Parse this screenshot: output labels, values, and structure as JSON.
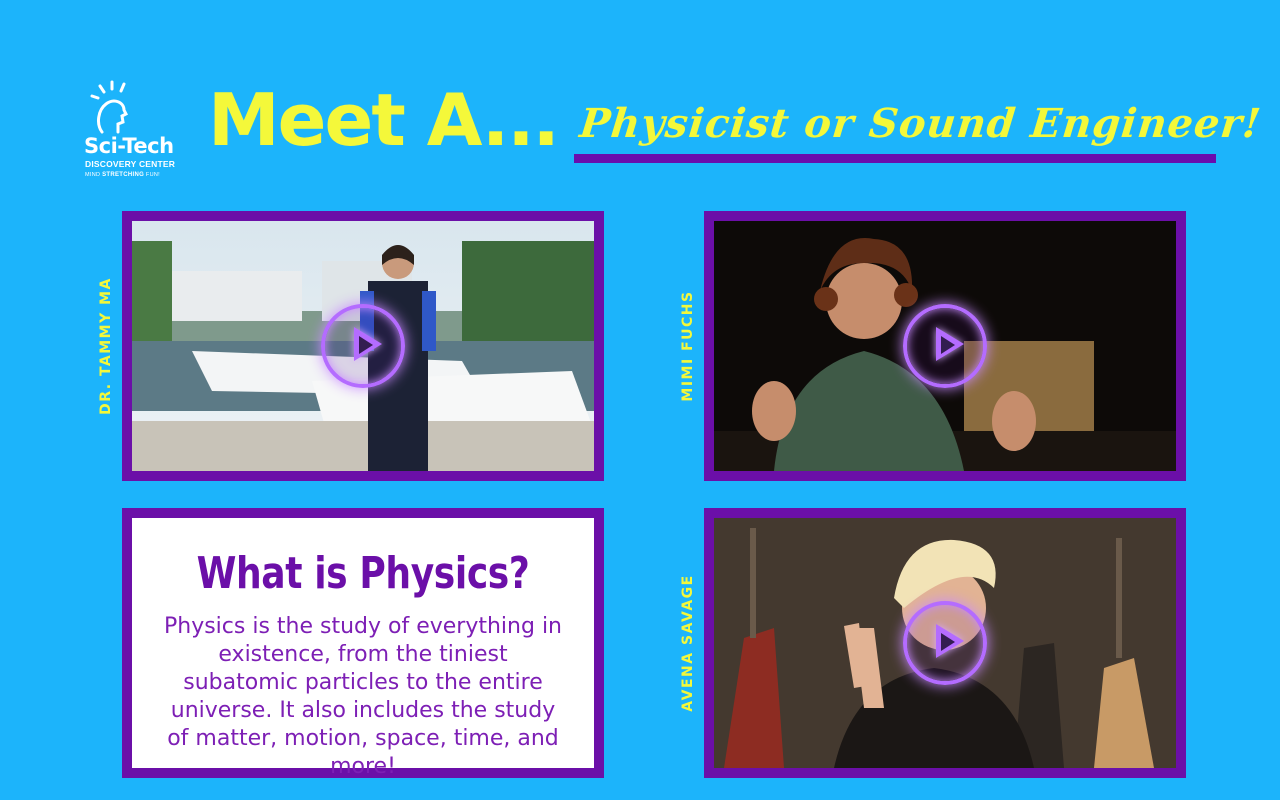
{
  "logo": {
    "brand": "Sci-Tech",
    "subtitle": "DISCOVERY CENTER",
    "tagline_pre": "MIND",
    "tagline_bold": "STRETCHING",
    "tagline_post": "FUN!"
  },
  "header": {
    "title": "Meet A...",
    "subtitle": "Physicist or Sound Engineer!"
  },
  "videos": [
    {
      "name": "DR. TAMMY MA",
      "thumbnail": "person-on-dock-with-boats"
    },
    {
      "name": "MIMI FUCHS",
      "thumbnail": "person-talking-dark-studio"
    },
    {
      "name": "AVENA SAVAGE",
      "thumbnail": "person-peace-sign-guitars"
    }
  ],
  "info": {
    "heading": "What is Physics?",
    "body": "Physics is the study of everything in existence, from the tiniest subatomic particles to the entire universe. It also includes the study of matter, motion, space, time, and more!"
  },
  "colors": {
    "background": "#1cb4fb",
    "accent_yellow": "#f4f83a",
    "frame_purple": "#6b0fa8",
    "play_glow": "#b46cff"
  },
  "icons": {
    "play": "play-circle-icon",
    "logo": "sci-tech-head-icon"
  }
}
